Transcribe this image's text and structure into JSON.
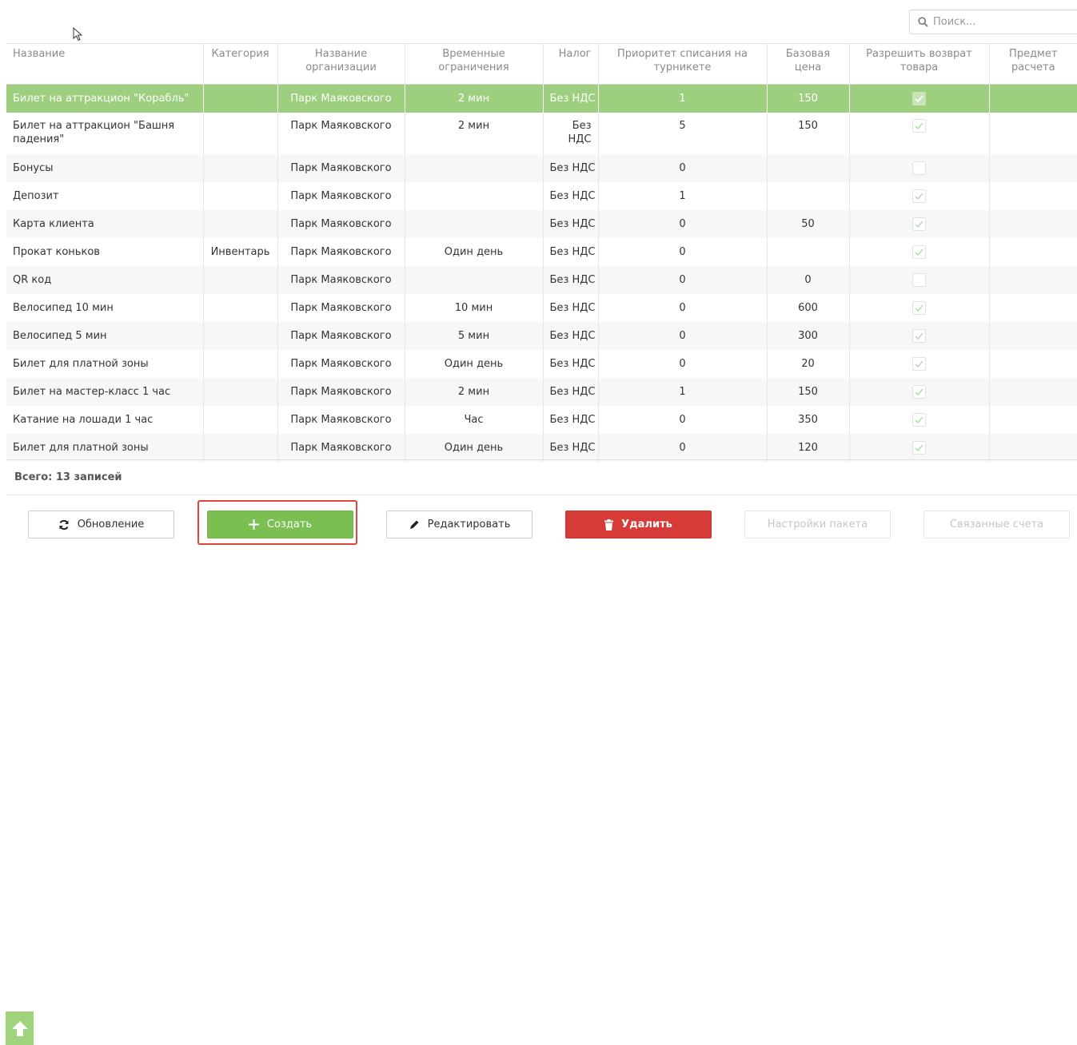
{
  "search": {
    "placeholder": "Поиск..."
  },
  "table": {
    "columns": [
      "Название",
      "Категория",
      "Название организации",
      "Временные ограничения",
      "Налог",
      "Приоритет списания на турникете",
      "Базовая цена",
      "Разрешить возврат товара",
      "Предмет расчета"
    ],
    "rows": [
      {
        "name": "Билет на аттракцион \"Корабль\"",
        "category": "",
        "org": "Парк Маяковского",
        "time": "2 мин",
        "tax": "Без НДС",
        "priority": "1",
        "price": "150",
        "refund": true,
        "subject": ""
      },
      {
        "name": "Билет на аттракцион \"Башня падения\"",
        "category": "",
        "org": "Парк Маяковского",
        "time": "2 мин",
        "tax": "Без НДС",
        "priority": "5",
        "price": "150",
        "refund": true,
        "subject": ""
      },
      {
        "name": "Бонусы",
        "category": "",
        "org": "Парк Маяковского",
        "time": "",
        "tax": "Без НДС",
        "priority": "0",
        "price": "",
        "refund": false,
        "subject": ""
      },
      {
        "name": "Депозит",
        "category": "",
        "org": "Парк Маяковского",
        "time": "",
        "tax": "Без НДС",
        "priority": "1",
        "price": "",
        "refund": true,
        "subject": ""
      },
      {
        "name": "Карта клиента",
        "category": "",
        "org": "Парк Маяковского",
        "time": "",
        "tax": "Без НДС",
        "priority": "0",
        "price": "50",
        "refund": true,
        "subject": ""
      },
      {
        "name": "Прокат коньков",
        "category": "Инвентарь",
        "org": "Парк Маяковского",
        "time": "Один день",
        "tax": "Без НДС",
        "priority": "0",
        "price": "",
        "refund": true,
        "subject": ""
      },
      {
        "name": "QR код",
        "category": "",
        "org": "Парк Маяковского",
        "time": "",
        "tax": "Без НДС",
        "priority": "0",
        "price": "0",
        "refund": false,
        "subject": ""
      },
      {
        "name": "Велосипед 10 мин",
        "category": "",
        "org": "Парк Маяковского",
        "time": "10 мин",
        "tax": "Без НДС",
        "priority": "0",
        "price": "600",
        "refund": true,
        "subject": ""
      },
      {
        "name": "Велосипед 5 мин",
        "category": "",
        "org": "Парк Маяковского",
        "time": "5 мин",
        "tax": "Без НДС",
        "priority": "0",
        "price": "300",
        "refund": true,
        "subject": ""
      },
      {
        "name": "Билет для платной зоны",
        "category": "",
        "org": "Парк Маяковского",
        "time": "Один день",
        "tax": "Без НДС",
        "priority": "0",
        "price": "20",
        "refund": true,
        "subject": ""
      },
      {
        "name": "Билет на мастер-класс 1 час",
        "category": "",
        "org": "Парк Маяковского",
        "time": "2 мин",
        "tax": "Без НДС",
        "priority": "1",
        "price": "150",
        "refund": true,
        "subject": ""
      },
      {
        "name": "Катание на лошади 1 час",
        "category": "",
        "org": "Парк Маяковского",
        "time": "Час",
        "tax": "Без НДС",
        "priority": "0",
        "price": "350",
        "refund": true,
        "subject": ""
      },
      {
        "name": "Билет для платной зоны",
        "category": "",
        "org": "Парк Маяковского",
        "time": "Один день",
        "tax": "Без НДС",
        "priority": "0",
        "price": "120",
        "refund": true,
        "subject": ""
      }
    ],
    "selected_row": 0,
    "total_label": "Всего: 13 записей"
  },
  "toolbar": {
    "refresh_label": "Обновление",
    "create_label": "Создать",
    "edit_label": "Редактировать",
    "delete_label": "Удалить",
    "package_settings_label": "Настройки пакета",
    "linked_accounts_label": "Связанные счета"
  },
  "colors": {
    "selected_row": "#9dcf7f",
    "create_button": "#7bbf52",
    "delete_button": "#d63b38",
    "highlight_box": "#e0463c"
  },
  "icons": {
    "search": "search-icon",
    "refresh": "refresh-icon",
    "create": "plus-icon",
    "edit": "pencil-icon",
    "delete": "trash-icon",
    "scroll_top": "arrow-up-icon",
    "cursor": "mouse-cursor-icon"
  }
}
